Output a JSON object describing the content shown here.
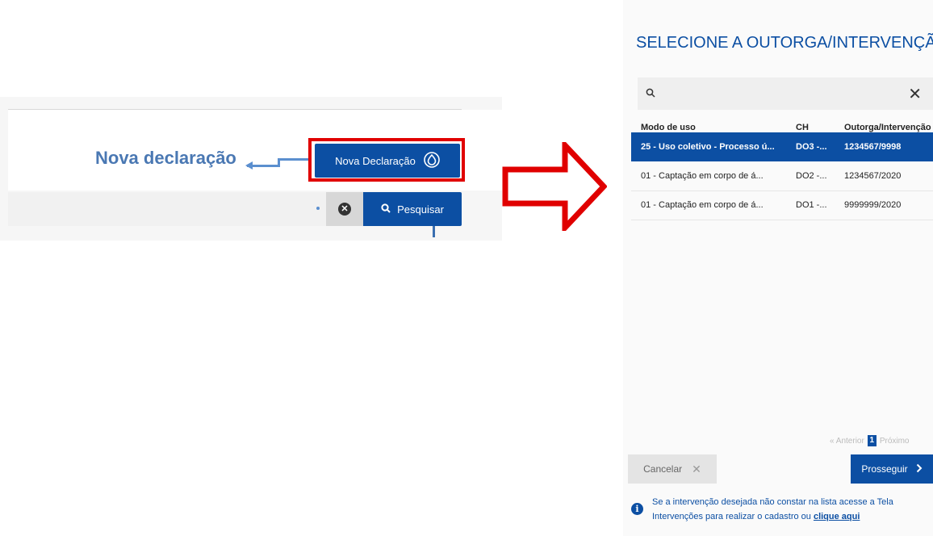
{
  "annotation": {
    "label": "Nova declaração"
  },
  "toolbar": {
    "nova_declaracao_label": "Nova Declaração",
    "nova_declaracao_icon": "water-drop-icon",
    "clear_icon": "clear-circle-icon",
    "search_label": "Pesquisar",
    "search_icon": "search-icon"
  },
  "modal": {
    "title": "SELECIONE A OUTORGA/INTERVENÇÃO",
    "search": {
      "icon": "search-icon",
      "clear_icon": "close-icon"
    },
    "columns": [
      "Modo de uso",
      "CH",
      "Outorga/Intervenção"
    ],
    "rows": [
      {
        "modo": "25 - Uso coletivo - Processo ú...",
        "ch": "DO3 -...",
        "outorga": "1234567/9998",
        "selected": true
      },
      {
        "modo": "01 - Captação em corpo de á...",
        "ch": "DO2 -...",
        "outorga": "1234567/2020",
        "selected": false
      },
      {
        "modo": "01 - Captação em corpo de á...",
        "ch": "DO1 -...",
        "outorga": "9999999/2020",
        "selected": false
      }
    ],
    "pagination": {
      "prev": "« Anterior",
      "current": "1",
      "next": "Próximo"
    },
    "cancel_label": "Cancelar",
    "proceed_label": "Prosseguir",
    "info": {
      "text_before": "Se a intervenção desejada não constar na lista acesse a Tela Intervenções para realizar o cadastro ou ",
      "link": "clique aqui"
    }
  },
  "colors": {
    "primary": "#0c4fa3",
    "highlight": "#e00000",
    "annotation": "#4a78b3"
  }
}
